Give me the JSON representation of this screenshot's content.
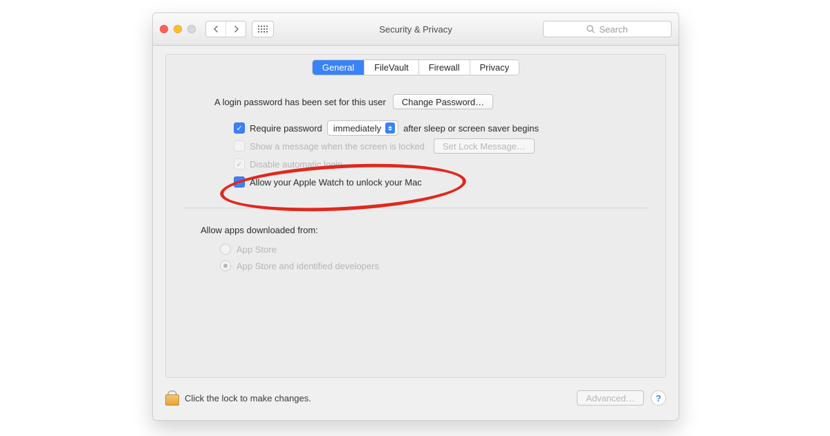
{
  "window": {
    "title": "Security & Privacy"
  },
  "toolbar": {
    "search_placeholder": "Search"
  },
  "tabs": {
    "items": [
      "General",
      "FileVault",
      "Firewall",
      "Privacy"
    ],
    "active": "General"
  },
  "general": {
    "login_password_text": "A login password has been set for this user",
    "change_password_label": "Change Password…",
    "require_password": {
      "label_pre": "Require password",
      "select_value": "immediately",
      "label_post": "after sleep or screen saver begins",
      "checked": true
    },
    "show_message": {
      "label": "Show a message when the screen is locked",
      "button_label": "Set Lock Message…",
      "checked": false,
      "enabled": false
    },
    "disable_auto_login": {
      "label": "Disable automatic login",
      "checked": true,
      "enabled": false
    },
    "apple_watch": {
      "label": "Allow your Apple Watch to unlock your Mac",
      "checked": true
    }
  },
  "gatekeeper": {
    "heading": "Allow apps downloaded from:",
    "options": [
      "App Store",
      "App Store and identified developers"
    ],
    "selected_index": 1,
    "enabled": false
  },
  "footer": {
    "lock_text": "Click the lock to make changes.",
    "advanced_label": "Advanced…",
    "help_label": "?"
  }
}
